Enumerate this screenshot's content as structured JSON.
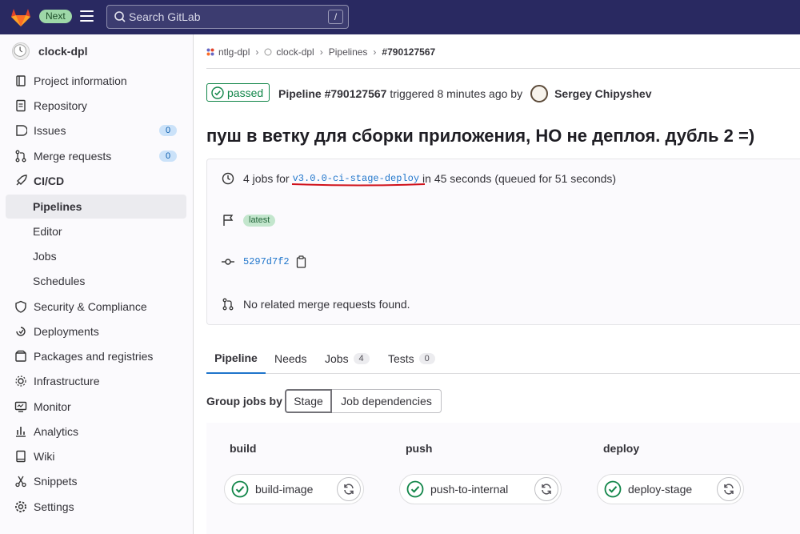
{
  "topbar": {
    "next_badge": "Next",
    "search_placeholder": "Search GitLab",
    "search_shortcut": "/"
  },
  "sidebar": {
    "project_name": "clock-dpl",
    "items": [
      {
        "label": "Project information",
        "icon": "project-icon"
      },
      {
        "label": "Repository",
        "icon": "doc-icon"
      },
      {
        "label": "Issues",
        "icon": "issues-icon",
        "count": "0"
      },
      {
        "label": "Merge requests",
        "icon": "merge-request-icon",
        "count": "0"
      },
      {
        "label": "CI/CD",
        "icon": "rocket-icon"
      },
      {
        "label": "Pipelines"
      },
      {
        "label": "Editor"
      },
      {
        "label": "Jobs"
      },
      {
        "label": "Schedules"
      },
      {
        "label": "Security & Compliance",
        "icon": "shield-icon"
      },
      {
        "label": "Deployments",
        "icon": "deployments-icon"
      },
      {
        "label": "Packages and registries",
        "icon": "package-icon"
      },
      {
        "label": "Infrastructure",
        "icon": "cloud-gear-icon"
      },
      {
        "label": "Monitor",
        "icon": "monitor-icon"
      },
      {
        "label": "Analytics",
        "icon": "chart-icon"
      },
      {
        "label": "Wiki",
        "icon": "book-icon"
      },
      {
        "label": "Snippets",
        "icon": "scissors-icon"
      },
      {
        "label": "Settings",
        "icon": "gear-icon"
      }
    ]
  },
  "breadcrumb": [
    "ntlg-dpl",
    "clock-dpl",
    "Pipelines",
    "#790127567"
  ],
  "pipeline": {
    "status": "passed",
    "name": "Pipeline #790127567",
    "triggered_text": "triggered 8 minutes ago by",
    "user": "Sergey Chipyshev",
    "title": "пуш в ветку для сборки приложения, НО не деплоя. дубль 2 =)"
  },
  "info": {
    "jobs_prefix": "4 jobs for",
    "ref": "v3.0.0-ci-stage-deploy",
    "jobs_suffix": "in 45 seconds (queued for 51 seconds)",
    "latest_badge": "latest",
    "sha": "5297d7f2",
    "merge_requests": "No related merge requests found."
  },
  "tabs": [
    {
      "label": "Pipeline"
    },
    {
      "label": "Needs"
    },
    {
      "label": "Jobs",
      "count": "4"
    },
    {
      "label": "Tests",
      "count": "0"
    }
  ],
  "group_jobs": {
    "label": "Group jobs by",
    "options": [
      "Stage",
      "Job dependencies"
    ],
    "selected": "Stage"
  },
  "stages": [
    {
      "name": "build",
      "job": "build-image"
    },
    {
      "name": "push",
      "job": "push-to-internal"
    },
    {
      "name": "deploy",
      "job": "deploy-stage"
    }
  ],
  "colors": {
    "topbar": "#292961",
    "success": "#108548",
    "link": "#1f75cb",
    "annotation_underline": "#d0111b"
  }
}
